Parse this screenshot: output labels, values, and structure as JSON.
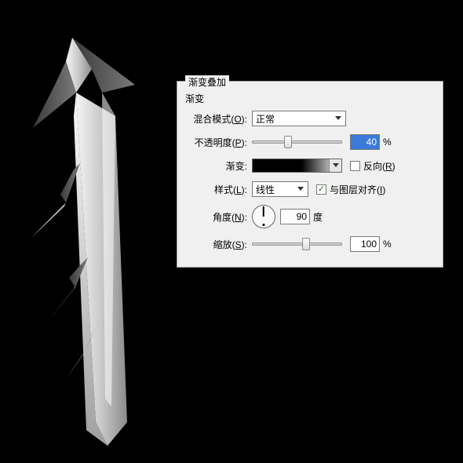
{
  "panel": {
    "title": "渐变叠加",
    "subtitle": "渐变",
    "blend_mode": {
      "label_pre": "混合模式(",
      "hot": "O",
      "label_post": "):",
      "value": "正常"
    },
    "opacity": {
      "label_pre": "不透明度(",
      "hot": "P",
      "label_post": "):",
      "value": "40",
      "unit": "%",
      "slider_pct": 40
    },
    "gradient": {
      "label": "渐变:",
      "reverse_pre": "反向(",
      "reverse_hot": "R",
      "reverse_post": ")",
      "reverse_checked": false
    },
    "style": {
      "label_pre": "样式(",
      "hot": "L",
      "label_post": "):",
      "value": "线性",
      "align_pre": "与图层对齐(",
      "align_hot": "I",
      "align_post": ")",
      "align_checked": true
    },
    "angle": {
      "label_pre": "角度(",
      "hot": "N",
      "label_post": "):",
      "value": "90",
      "unit": "度"
    },
    "scale": {
      "label_pre": "缩放(",
      "hot": "S",
      "label_post": "):",
      "value": "100",
      "unit": "%",
      "slider_pct": 60
    }
  }
}
